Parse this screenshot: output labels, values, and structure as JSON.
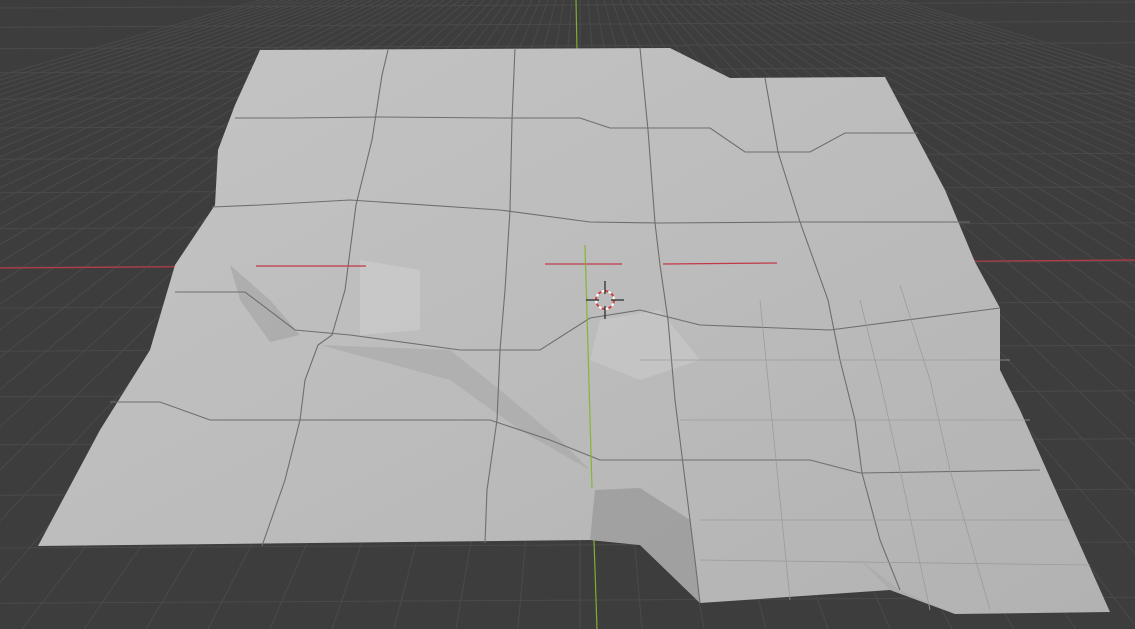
{
  "viewport": {
    "background_color": "#3d3d3d",
    "grid_color": "#4a4a4a",
    "x_axis_color": "#c2384a",
    "y_axis_color": "#86b536",
    "mesh_color": "#bdbdbd",
    "mesh_edge_color": "#6e6e6e",
    "cursor_icon": "3d-cursor-icon"
  }
}
